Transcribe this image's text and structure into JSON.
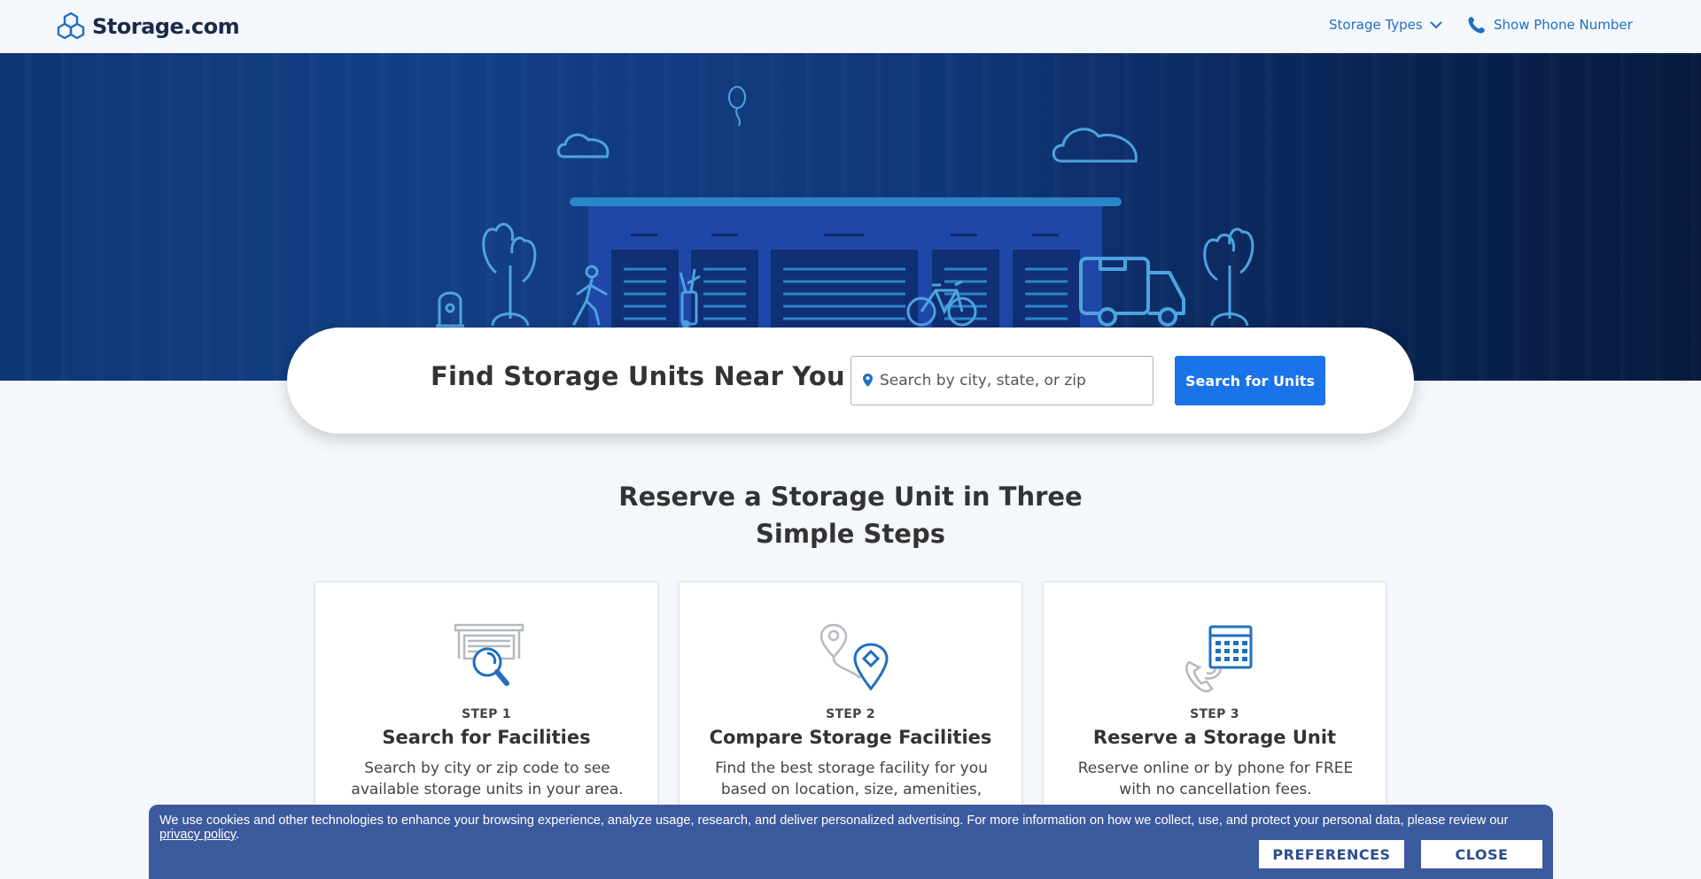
{
  "header": {
    "logo_text": "Storage.com",
    "nav_storage_types": "Storage Types",
    "nav_phone": "Show Phone Number"
  },
  "search": {
    "title": "Find Storage Units Near You",
    "placeholder": "Search by city, state, or zip",
    "button": "Search for Units"
  },
  "steps": {
    "heading_line1": "Reserve a Storage Unit in Three",
    "heading_line2": "Simple Steps",
    "items": [
      {
        "label": "STEP 1",
        "title": "Search for Facilities",
        "desc": "Search by city or zip code to see available storage units in your area.",
        "icon": "storage-search-icon"
      },
      {
        "label": "STEP 2",
        "title": "Compare Storage Facilities",
        "desc": "Find the best storage facility for you based on location, size, amenities,",
        "icon": "map-pin-compare-icon"
      },
      {
        "label": "STEP 3",
        "title": "Reserve a Storage Unit",
        "desc": "Reserve online or by phone for FREE with no cancellation fees.",
        "icon": "calendar-phone-icon"
      }
    ]
  },
  "cookie": {
    "text": "We use cookies and other technologies to enhance your browsing experience, analyze usage, research, and deliver personalized advertising. For more information on how we collect, use, and protect your personal data, please review our ",
    "link": "privacy policy",
    "after_link": ".",
    "preferences_button": "PREFERENCES",
    "close_button": "CLOSE"
  },
  "colors": {
    "brand_blue": "#1a73e8",
    "link_blue": "#1f6fc0",
    "hero_dark": "#0e3676",
    "cookie_bg": "#3c5a9e",
    "icon_outline": "#4da3e0"
  }
}
